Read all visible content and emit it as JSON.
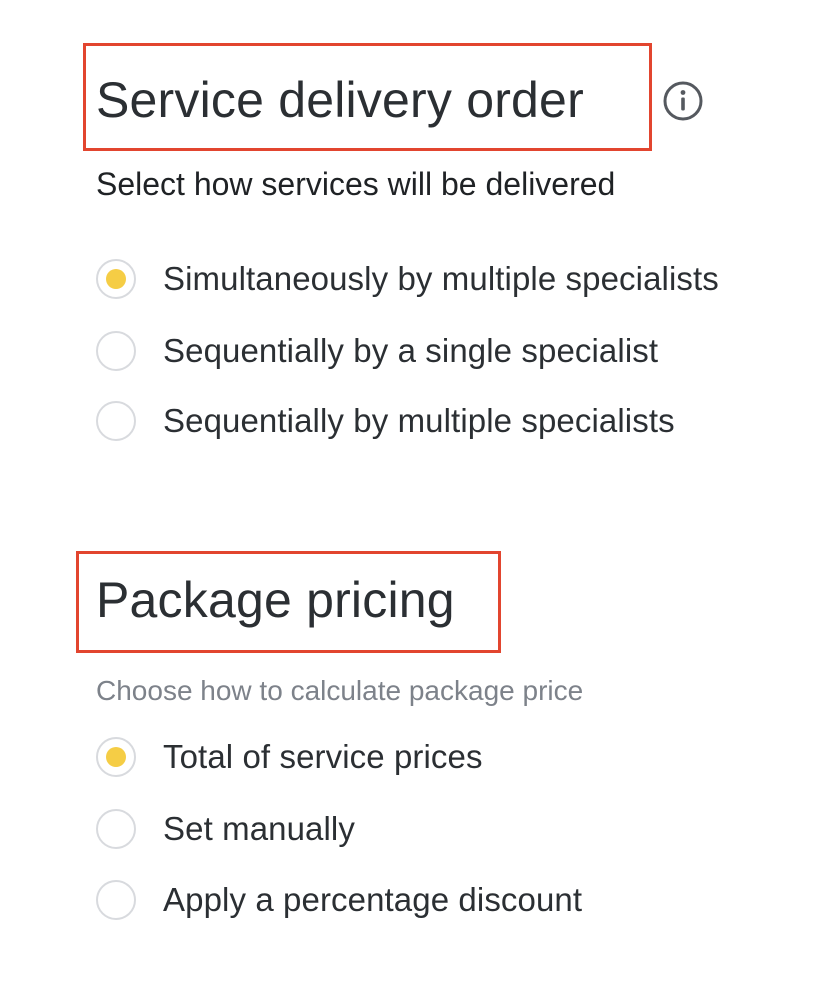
{
  "delivery": {
    "title": "Service delivery order",
    "info_icon": "info-icon",
    "subtitle": "Select how services will be delivered",
    "options": [
      {
        "label": "Simultaneously by multiple specialists",
        "checked": true
      },
      {
        "label": "Sequentially by a single specialist",
        "checked": false
      },
      {
        "label": "Sequentially by multiple specialists",
        "checked": false
      }
    ]
  },
  "pricing": {
    "title": "Package pricing",
    "subtitle": "Choose how to calculate package price",
    "options": [
      {
        "label": "Total of service prices",
        "checked": true
      },
      {
        "label": "Set manually",
        "checked": false
      },
      {
        "label": "Apply a percentage discount",
        "checked": false
      }
    ]
  },
  "colors": {
    "highlight_border": "#e2452f",
    "radio_selected": "#f5cd45",
    "radio_border": "#d8dade",
    "text": "#2b2f33",
    "muted_text": "#7d828a"
  }
}
